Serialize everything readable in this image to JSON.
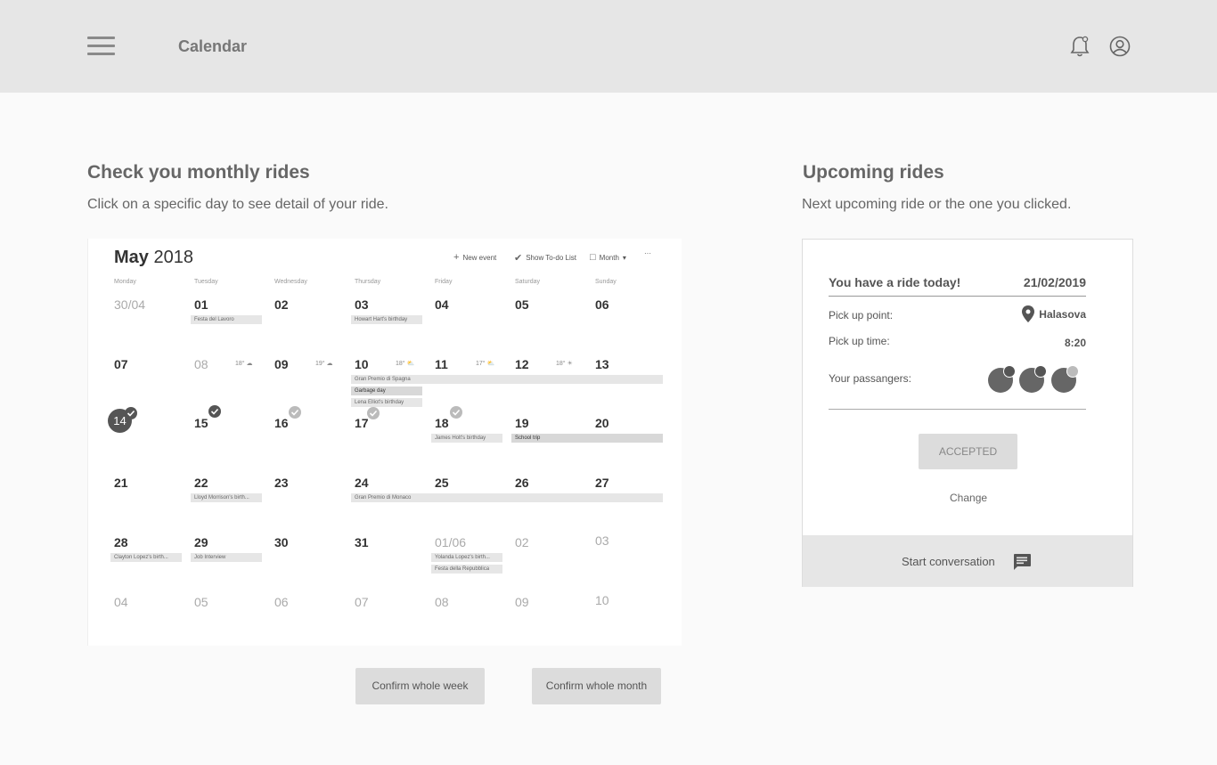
{
  "header": {
    "title": "Calendar",
    "menu_icon": "hamburger-icon",
    "bell_icon": "bell-icon",
    "profile_icon": "user-circle-icon"
  },
  "left": {
    "title": "Check you monthly rides",
    "subtitle": "Click on a specific day to see detail of your ride.",
    "confirm_week": "Confirm whole week",
    "confirm_month": "Confirm whole month"
  },
  "calendar": {
    "month": "May",
    "year": "2018",
    "tools": {
      "new_event": "New event",
      "todo": "Show To-do List",
      "view": "Month",
      "more": "···"
    },
    "weekdays": [
      "Monday",
      "Tuesday",
      "Wednesday",
      "Thursday",
      "Friday",
      "Saturday",
      "Sunday"
    ],
    "weeks": [
      [
        "30/04",
        "01",
        "02",
        "03",
        "04",
        "05",
        "06"
      ],
      [
        "07",
        "08",
        "09",
        "10",
        "11",
        "12",
        "13"
      ],
      [
        "14",
        "15",
        "16",
        "17",
        "18",
        "19",
        "20"
      ],
      [
        "21",
        "22",
        "23",
        "24",
        "25",
        "26",
        "27"
      ],
      [
        "28",
        "29",
        "30",
        "31",
        "01/06",
        "02",
        "03"
      ],
      [
        "04",
        "05",
        "06",
        "07",
        "08",
        "09",
        "10"
      ]
    ],
    "events": {
      "festa_lavoro": "Festa del Lavoro",
      "howart": "Howart Hart's birthday",
      "gran_premio_spagna": "Gran Premio di Spagna",
      "garbage": "Garbage day",
      "lena": "Lena Elliot's birthday",
      "james": "James Holt's birthday",
      "school": "School trip",
      "lloyd": "Lloyd Morrison's birth...",
      "gran_premio_monaco": "Gran Premio di Monaco",
      "clayton": "Clayton Lopez's birth...",
      "job": "Job Interview",
      "yolanda": "Yolanda Lopez's birth...",
      "festa_repubblica": "Festa della Repubblica"
    },
    "weather": {
      "w08": "18°",
      "w09": "19°",
      "w10": "18°",
      "w11": "17°",
      "w12": "18°"
    }
  },
  "right": {
    "title": "Upcoming rides",
    "subtitle": "Next upcoming ride or the one you clicked."
  },
  "ride": {
    "heading": "You have a ride today!",
    "date": "21/02/2019",
    "pickup_point_label": "Pick up point:",
    "pickup_point": "Halasova",
    "pickup_time_label": "Pick up time:",
    "pickup_time": "8:20",
    "passengers_label": "Your passangers:",
    "status": "ACCEPTED",
    "change": "Change",
    "conversation": "Start conversation"
  }
}
